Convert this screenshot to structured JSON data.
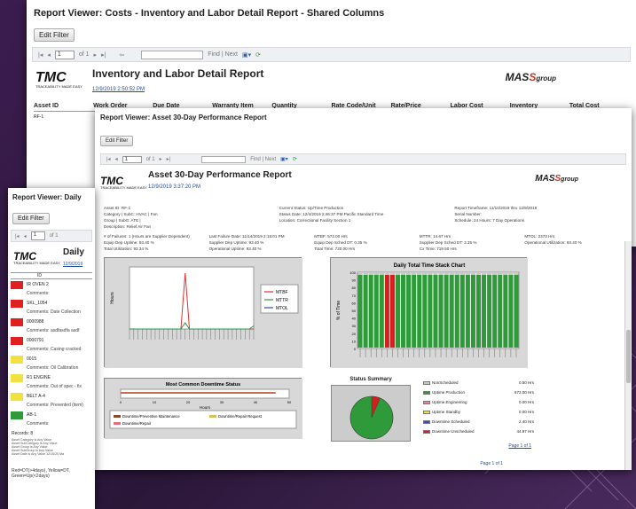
{
  "win_back": {
    "title": "Report Viewer: Costs - Inventory and Labor Detail Report - Shared Columns",
    "edit_filter": "Edit Filter",
    "page": "1",
    "of": "of 1",
    "find": "Find | Next",
    "report_title": "Inventory and Labor Detail Report",
    "report_date": "12/9/2019 2:50:52 PM",
    "columns": [
      "Asset ID",
      "Work Order",
      "Due Date",
      "Warranty Item",
      "Quantity",
      "Rate Code/Unit",
      "Rate/Price",
      "Labor Cost",
      "Inventory",
      "Total Cost"
    ],
    "row1": "RF-1"
  },
  "win_mid": {
    "title": "Report Viewer: Asset 30-Day Performance Report",
    "edit_filter": "Edit Filter",
    "page": "1",
    "of": "of 1",
    "find": "Find | Next",
    "report_title": "Asset 30-Day Performance Report",
    "report_date": "12/9/2019 3:37:20 PM",
    "kv": [
      "Asset ID: RF-1",
      "Current Status: Up/Time Production",
      "Report Timeframe: 11/10/2019 thru 12/9/2019",
      "Category | SubC: HVAC | Fan",
      "Status Date: 12/4/2019 2:46:37 PM Pacific Standard Time",
      "Serial Number:",
      "Group | SubG: ATE |",
      "Location: Correctional Facility Section 1",
      "Schedule: 24 Hours: 7 Day Operations",
      "Description: Relief Air Fan"
    ],
    "stats": [
      "# of Failures: 1 (Hours are Supplier Dependent)",
      "Last Failure Date: 11/14/2019 2:15:01 PM",
      "MTBF: 572.00 Hrs",
      "MTTR: 14.67 Hrs",
      "MTOL: 2373 Hrs",
      "Equip Dep Uptime: 93.40 %",
      "Supplier Dep Uptime: 93.40 %",
      "Equip Dep Sched DT: 0.35 %",
      "Supplier Dep Sched DT: 3.35 %",
      "Operational Utilization: 93.40 %",
      "Total Utilization: 93.34 %",
      "Operational Uptime: 93.40 %",
      "Total Time: 720.00 Hrs",
      "Cx Time: 719.50 Hrs"
    ]
  },
  "win_front": {
    "title": "Report Viewer: Daily",
    "edit_filter": "Edit Filter",
    "page": "1",
    "of": "of 1",
    "report_title": "Daily",
    "report_date": "12/9/2019",
    "id_header": "ID",
    "rows": [
      {
        "id": "IR OVEN 2",
        "color": "#e02020",
        "comment": "Comments:"
      },
      {
        "id": "SKL_1054",
        "color": "#e02020",
        "comment": "Comments: Date Collection"
      },
      {
        "id": "0000988",
        "color": "#e02020",
        "comment": "Comments: asdfasdfa asdf"
      },
      {
        "id": "0000791",
        "color": "#e02020",
        "comment": "Comments: Casing cracked"
      },
      {
        "id": "0015",
        "color": "#f2e040",
        "comment": "Comments: Oil Calibration"
      },
      {
        "id": "R1 ENGINE",
        "color": "#f2e040",
        "comment": "Comments: Out of spec - fix"
      },
      {
        "id": "BELT A-4",
        "color": "#f2e040",
        "comment": "Comments: Prevented (item)"
      },
      {
        "id": "AB-1",
        "color": "#2e9a3a",
        "comment": "Comments:"
      }
    ],
    "records": "Records: 8",
    "legend_lines": [
      "Asset Category is Any Value",
      "Asset SubCategory is Any Value",
      "Asset Group is Any Value",
      "Asset SubGroup is Any Value",
      "Asset Date is Any Value 12/10/20 Ma"
    ],
    "footer": "Red=DT(>4days), Yellow=DT, Green=Up(<2days)",
    "page_footer": "Page 1 of 1"
  },
  "charts": {
    "line_ylabel": "Hours",
    "line_legend": [
      "MTBF",
      "MTTR",
      "MTOL"
    ],
    "line_colors": [
      "#e03030",
      "#2a9a4a",
      "#2a4aa0"
    ],
    "stack_title": "Daily Total Time Stack Chart",
    "stack_ylabel": "% of Time",
    "stack_yticks": [
      "100",
      "90",
      "80",
      "70",
      "60",
      "50",
      "40",
      "30",
      "20",
      "10",
      "0"
    ],
    "downtime_title": "Most Common Downtime Status",
    "downtime_xlabel": "Hours",
    "downtime_ticks": [
      "0",
      "10",
      "20",
      "30",
      "40",
      "50"
    ],
    "downtime_legend": [
      "Downtime/Preventive Maintenance",
      "Downtime/Repair Request",
      "Downtime/Repair"
    ],
    "status_title": "Status Summary",
    "status_items": [
      {
        "label": "NonScheduled",
        "value": "0.50 Hrs",
        "color": "#c8c8c8"
      },
      {
        "label": "Uptime Production",
        "value": "672.00 Hrs",
        "color": "#2e9a3a"
      },
      {
        "label": "Uptime Engineering",
        "value": "0.00 Hrs",
        "color": "#f07aa0"
      },
      {
        "label": "Uptime Standby",
        "value": "0.00 Hrs",
        "color": "#f2e040"
      },
      {
        "label": "Downtime Scheduled",
        "value": "2.40 Hrs",
        "color": "#3050c0"
      },
      {
        "label": "Downtime Unscheduled",
        "value": "44.97 Hrs",
        "color": "#d02020"
      }
    ],
    "status_page": "Page 1 of 1",
    "mid_page": "Page 1 of 1",
    "line_series": {
      "MTBF": [
        0,
        0,
        0,
        0,
        0,
        0,
        0,
        0,
        0,
        0,
        0,
        0,
        0,
        18,
        0,
        0,
        0,
        0,
        0,
        0,
        0,
        0,
        0,
        0,
        0,
        0,
        0,
        0,
        0,
        0
      ],
      "MTTR": [
        0,
        0,
        0,
        0,
        0,
        0,
        0,
        0,
        0,
        0,
        0,
        0,
        0,
        2,
        0,
        0,
        0,
        0,
        0,
        0,
        0,
        0,
        0,
        0,
        0,
        0,
        0,
        0,
        0,
        1
      ]
    },
    "stack_red_days": [
      5,
      6
    ]
  }
}
